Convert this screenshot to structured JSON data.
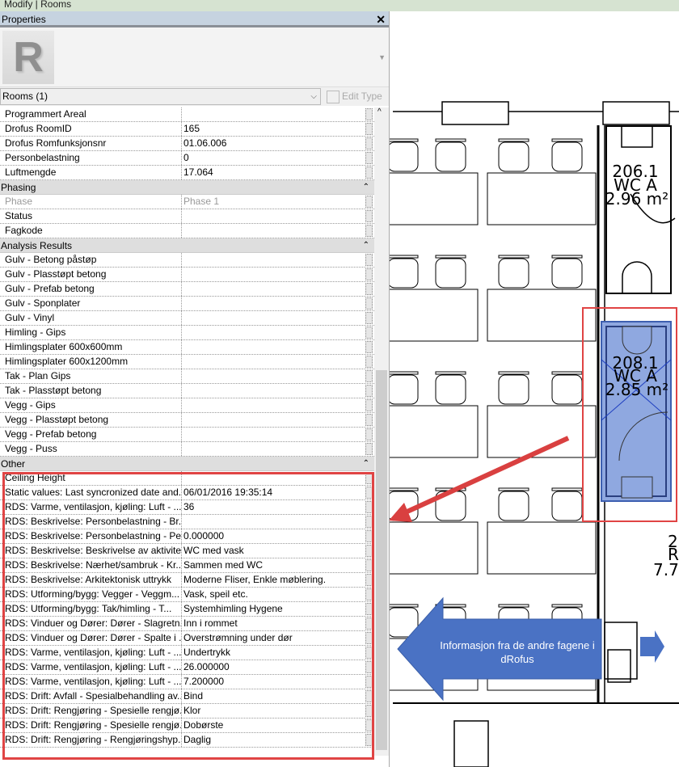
{
  "window": {
    "title": "Modify | Rooms"
  },
  "properties": {
    "title": "Properties",
    "close": "✕",
    "type_selector": "Rooms (1)",
    "edit_type": "Edit Type",
    "logo_letter": "R"
  },
  "groups": [
    {
      "name": "",
      "rows": [
        {
          "name": "Programmert Areal",
          "value": ""
        },
        {
          "name": "Drofus RoomID",
          "value": "165"
        },
        {
          "name": "Drofus Romfunksjonsnr",
          "value": "01.06.006"
        },
        {
          "name": "Personbelastning",
          "value": "0"
        },
        {
          "name": "Luftmengde",
          "value": "17.064"
        }
      ]
    },
    {
      "name": "Phasing",
      "rows": [
        {
          "name": "Phase",
          "value": "Phase 1",
          "disabled": true
        },
        {
          "name": "Status",
          "value": ""
        },
        {
          "name": "Fagkode",
          "value": ""
        }
      ]
    },
    {
      "name": "Analysis Results",
      "rows": [
        {
          "name": "Gulv - Betong påstøp",
          "value": ""
        },
        {
          "name": "Gulv - Plasstøpt betong",
          "value": ""
        },
        {
          "name": "Gulv - Prefab betong",
          "value": ""
        },
        {
          "name": "Gulv - Sponplater",
          "value": ""
        },
        {
          "name": "Gulv - Vinyl",
          "value": ""
        },
        {
          "name": "Himling - Gips",
          "value": ""
        },
        {
          "name": "Himlingsplater 600x600mm",
          "value": ""
        },
        {
          "name": "Himlingsplater 600x1200mm",
          "value": ""
        },
        {
          "name": "Tak - Plan Gips",
          "value": ""
        },
        {
          "name": "Tak - Plasstøpt betong",
          "value": ""
        },
        {
          "name": "Vegg - Gips",
          "value": ""
        },
        {
          "name": "Vegg - Plasstøpt betong",
          "value": ""
        },
        {
          "name": "Vegg - Prefab betong",
          "value": ""
        },
        {
          "name": "Vegg - Puss",
          "value": ""
        }
      ]
    },
    {
      "name": "Other",
      "rows": [
        {
          "name": "Ceiling Height",
          "value": ""
        },
        {
          "name": "Static values: Last syncronized date and...",
          "value": "06/01/2016 19:35:14"
        },
        {
          "name": "RDS: Varme, ventilasjon, kjøling: Luft - ...",
          "value": "36"
        },
        {
          "name": "RDS: Beskrivelse: Personbelastning - Br...",
          "value": ""
        },
        {
          "name": "RDS: Beskrivelse: Personbelastning - Pe...",
          "value": "0.000000"
        },
        {
          "name": "RDS: Beskrivelse: Beskrivelse av aktivitet...",
          "value": "WC med vask"
        },
        {
          "name": "RDS: Beskrivelse: Nærhet/sambruk - Kr...",
          "value": "Sammen med WC"
        },
        {
          "name": "RDS: Beskrivelse: Arkitektonisk uttrykk",
          "value": "Moderne Fliser, Enkle møblering."
        },
        {
          "name": "RDS: Utforming/bygg: Vegger - Veggm...",
          "value": "Vask, speil etc."
        },
        {
          "name": "RDS: Utforming/bygg: Tak/himling - T...",
          "value": "Systemhimling Hygene"
        },
        {
          "name": "RDS: Vinduer og Dører: Dører - Slagretn...",
          "value": "Inn i rommet"
        },
        {
          "name": "RDS: Vinduer og Dører: Dører - Spalte i ...",
          "value": "Overstrømning under dør"
        },
        {
          "name": "RDS: Varme, ventilasjon, kjøling: Luft - ...",
          "value": "Undertrykk"
        },
        {
          "name": "RDS: Varme, ventilasjon, kjøling: Luft - ...",
          "value": "26.000000"
        },
        {
          "name": "RDS: Varme, ventilasjon, kjøling: Luft - ...",
          "value": "7.200000"
        },
        {
          "name": "RDS: Drift: Avfall - Spesialbehandling av...",
          "value": "Bind"
        },
        {
          "name": "RDS: Drift: Rengjøring - Spesielle rengjø...",
          "value": "Klor"
        },
        {
          "name": "RDS: Drift: Rengjøring - Spesielle rengjø...",
          "value": "Dobørste"
        },
        {
          "name": "RDS: Drift: Rengjøring - Rengjøringshyp...",
          "value": "Daglig"
        }
      ]
    }
  ],
  "plan": {
    "rooms": [
      {
        "number": "206.1",
        "name": "WC A",
        "area": "2.96 m²"
      },
      {
        "number": "208.1",
        "name": "WC A",
        "area": "2.85 m²",
        "selected": true
      },
      {
        "number": "2",
        "name": "R",
        "area": "7.7"
      }
    ],
    "callout": "Informasjon fra de andre fagene i dRofus",
    "colors": {
      "selection": "#8fa8e0",
      "highlight": "#e04444",
      "callout": "#4a72c4"
    }
  }
}
